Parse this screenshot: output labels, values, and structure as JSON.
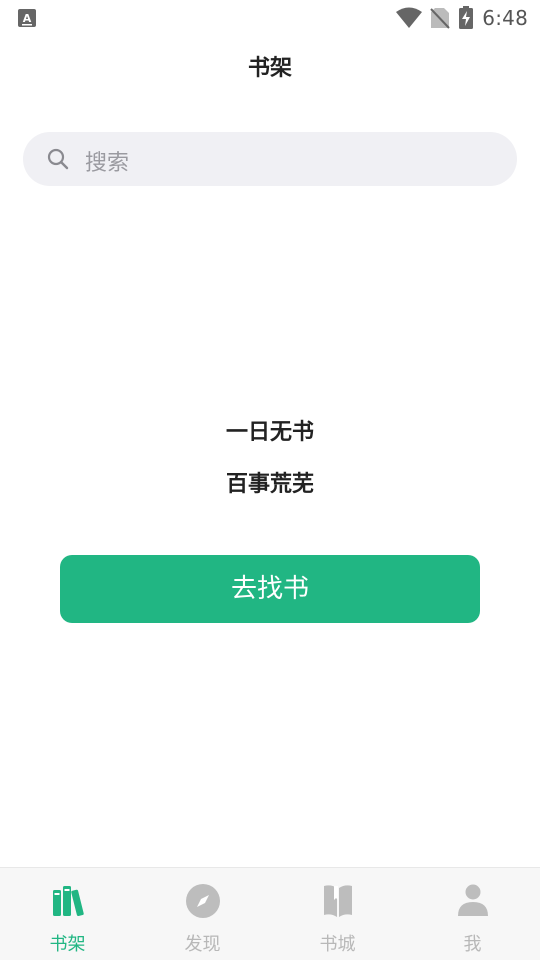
{
  "status_bar": {
    "time": "6:48",
    "icons": [
      "accessibility-icon",
      "wifi-icon",
      "no-sim-icon",
      "battery-charging-icon"
    ]
  },
  "header": {
    "title": "书架"
  },
  "search": {
    "placeholder": "搜索",
    "icon": "search-icon"
  },
  "empty_state": {
    "line1": "一日无书",
    "line2": "百事荒芜",
    "button_label": "去找书"
  },
  "bottom_nav": {
    "active_color": "#21b683",
    "inactive_color": "#b8b8b8",
    "items": [
      {
        "label": "书架",
        "icon": "bookshelf-icon",
        "active": true
      },
      {
        "label": "发现",
        "icon": "compass-icon",
        "active": false
      },
      {
        "label": "书城",
        "icon": "book-icon",
        "active": false
      },
      {
        "label": "我",
        "icon": "person-icon",
        "active": false
      }
    ]
  }
}
